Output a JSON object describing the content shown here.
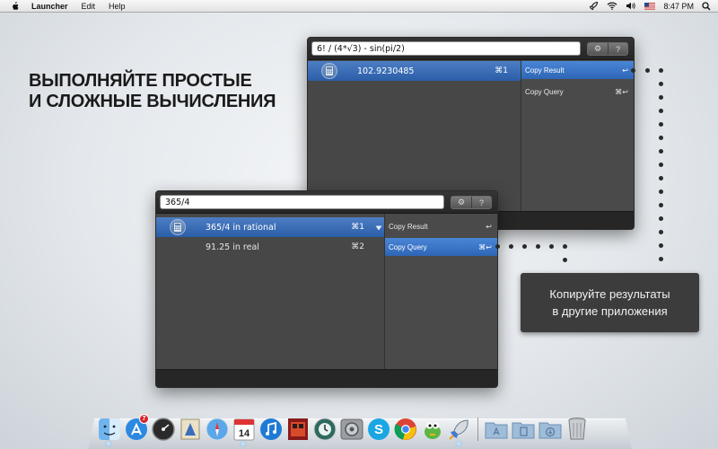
{
  "menubar": {
    "app_name": "Launcher",
    "items": [
      "Edit",
      "Help"
    ],
    "clock": "8:47 PM"
  },
  "headline": {
    "line1": "ВЫПОЛНЯЙТЕ ПРОСТЫЕ",
    "line2": "И СЛОЖНЫЕ ВЫЧИСЛЕНИЯ"
  },
  "callout": {
    "line1": "Копируйте результаты",
    "line2": "в другие приложения"
  },
  "window_back": {
    "query": "6! / (4*√3) - sin(pi/2)",
    "settings_label": "⚙",
    "help_label": "?",
    "results": [
      {
        "label": "102.9230485",
        "shortcut": "⌘1",
        "selected": true
      }
    ],
    "actions": [
      {
        "label": "Copy Result",
        "shortcut": "↩",
        "selected": true
      },
      {
        "label": "Copy Query",
        "shortcut": "⌘↩",
        "selected": false
      }
    ]
  },
  "window_front": {
    "query": "365/4",
    "settings_label": "⚙",
    "help_label": "?",
    "results": [
      {
        "label": "365/4 in rational",
        "shortcut": "⌘1",
        "selected": true
      },
      {
        "label": "91.25 in real",
        "shortcut": "⌘2",
        "selected": false
      }
    ],
    "actions": [
      {
        "label": "Copy Result",
        "shortcut": "↩",
        "selected": false
      },
      {
        "label": "Copy Query",
        "shortcut": "⌘↩",
        "selected": true
      }
    ]
  },
  "dock": {
    "badge_count": "7",
    "calendar_day": "14",
    "apps": [
      "finder",
      "app-store",
      "dashboard",
      "mail-stamp",
      "safari",
      "calendar",
      "itunes",
      "photo-booth",
      "time-machine",
      "system-preferences",
      "skype",
      "chrome",
      "adium",
      "launcher-rocket"
    ],
    "folders": [
      "applications-folder",
      "documents-folder",
      "downloads-folder"
    ],
    "trash": "trash"
  },
  "colors": {
    "selection": "#2b5ea8",
    "window_bg": "#474747",
    "callout_bg": "#3c3c3c"
  }
}
